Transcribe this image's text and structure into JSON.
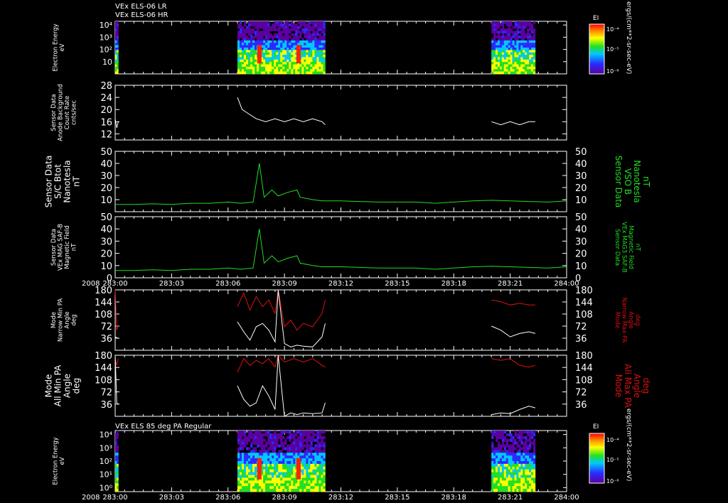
{
  "header": {
    "line1": "VEx ELS-06 LR",
    "line2": "VEx ELS-06 HR"
  },
  "year_label": "2008",
  "colorbar": {
    "label": "EI",
    "ticks": [
      "10⁻⁴",
      "10⁻⁵",
      "10⁻⁶"
    ],
    "units": "ergs/(cm**2-sr-sec-eV)"
  },
  "colors": {
    "trace_white": "#ffffff",
    "trace_green": "#22dd22",
    "trace_red": "#dd1111",
    "frame": "#ffffff"
  },
  "chart_data": [
    {
      "type": "heatmap",
      "id": "spec1",
      "ylabel": [
        "Electron Energy",
        "eV"
      ],
      "yticks": [
        "10⁴",
        "10³",
        "10²",
        "10"
      ],
      "ylog": true,
      "ylim": [
        1,
        20000
      ],
      "data_intervals": [
        [
          "283:00:00",
          "283:00:10"
        ],
        [
          "283:06:30",
          "283:11:10"
        ],
        [
          "283:20:00",
          "283:22:20"
        ]
      ]
    },
    {
      "type": "line",
      "id": "anode",
      "ylabel": [
        "Sensor Data",
        "Anode Background",
        "Count Rate",
        "cnts/sec"
      ],
      "yticks": [
        12,
        16,
        20,
        24,
        28
      ],
      "ylim": [
        10,
        28
      ],
      "series": [
        {
          "color": "#ffffff",
          "points": [
            [
              "283:00:00",
              17
            ],
            [
              "283:00:05",
              14
            ],
            [
              "283:00:10",
              16
            ],
            [
              "283:06:30",
              24
            ],
            [
              "283:06:45",
              20
            ],
            [
              "283:07:00",
              19
            ],
            [
              "283:07:30",
              17
            ],
            [
              "283:08:00",
              16
            ],
            [
              "283:08:30",
              17
            ],
            [
              "283:09:00",
              16
            ],
            [
              "283:09:30",
              17
            ],
            [
              "283:10:00",
              16
            ],
            [
              "283:10:30",
              17
            ],
            [
              "283:11:00",
              16
            ],
            [
              "283:11:10",
              15
            ],
            [
              "283:20:00",
              16
            ],
            [
              "283:20:30",
              15
            ],
            [
              "283:21:00",
              16
            ],
            [
              "283:21:30",
              15
            ],
            [
              "283:22:00",
              16
            ],
            [
              "283:22:20",
              16
            ]
          ]
        }
      ]
    },
    {
      "type": "line",
      "id": "bmag",
      "ylabel": [
        "Sensor Data",
        "S/C Btot",
        "Nanotesla",
        "nT"
      ],
      "ylabel_right": [
        "Sensor Data",
        "VSO B",
        "Nanotesla",
        "nT"
      ],
      "yticks": [
        10,
        20,
        30,
        40,
        50
      ],
      "ylim": [
        0,
        50
      ],
      "series": [
        {
          "color": "#22dd22",
          "points": [
            [
              "283:00:00",
              6
            ],
            [
              "283:01:00",
              6
            ],
            [
              "283:02:00",
              6.5
            ],
            [
              "283:03:00",
              6
            ],
            [
              "283:04:00",
              7
            ],
            [
              "283:05:00",
              7
            ],
            [
              "283:06:00",
              8
            ],
            [
              "283:06:40",
              7
            ],
            [
              "283:07:20",
              8
            ],
            [
              "283:07:40",
              40
            ],
            [
              "283:07:55",
              12
            ],
            [
              "283:08:20",
              18
            ],
            [
              "283:08:40",
              13
            ],
            [
              "283:09:10",
              16
            ],
            [
              "283:09:40",
              18
            ],
            [
              "283:09:50",
              12
            ],
            [
              "283:10:30",
              10
            ],
            [
              "283:11:00",
              9
            ],
            [
              "283:12:00",
              9
            ],
            [
              "283:13:00",
              8.5
            ],
            [
              "283:14:00",
              8
            ],
            [
              "283:15:00",
              8
            ],
            [
              "283:16:00",
              8
            ],
            [
              "283:17:00",
              7
            ],
            [
              "283:18:00",
              8
            ],
            [
              "283:19:00",
              9
            ],
            [
              "283:20:00",
              9.5
            ],
            [
              "283:21:00",
              9
            ],
            [
              "283:22:00",
              8.5
            ],
            [
              "283:23:00",
              8
            ],
            [
              "283:24:00",
              9
            ]
          ]
        }
      ]
    },
    {
      "type": "line",
      "id": "bmag2",
      "ylabel": [
        "Sensor Data",
        "VEx MAG SAF-B",
        "Magnetic Field",
        "nT"
      ],
      "ylabel_right": [
        "Sensor Data",
        "VEx MAG3 SAF-B",
        "Magnetic Field",
        "nT"
      ],
      "yticks": [
        0,
        10,
        20,
        30,
        40,
        50
      ],
      "ylim": [
        0,
        50
      ],
      "xticks": [
        "283:00",
        "283:03",
        "283:06",
        "283:09",
        "283:12",
        "283:15",
        "283:18",
        "283:21",
        "284:00"
      ],
      "series": [
        {
          "color": "#22dd22",
          "points": [
            [
              "283:00:00",
              6
            ],
            [
              "283:01:00",
              6
            ],
            [
              "283:02:00",
              6.5
            ],
            [
              "283:03:00",
              6
            ],
            [
              "283:04:00",
              7
            ],
            [
              "283:05:00",
              7
            ],
            [
              "283:06:00",
              8
            ],
            [
              "283:06:40",
              7
            ],
            [
              "283:07:20",
              8
            ],
            [
              "283:07:40",
              40
            ],
            [
              "283:07:55",
              12
            ],
            [
              "283:08:20",
              18
            ],
            [
              "283:08:40",
              13
            ],
            [
              "283:09:10",
              16
            ],
            [
              "283:09:40",
              18
            ],
            [
              "283:09:50",
              12
            ],
            [
              "283:10:30",
              10
            ],
            [
              "283:11:00",
              9
            ],
            [
              "283:12:00",
              9
            ],
            [
              "283:13:00",
              8.5
            ],
            [
              "283:14:00",
              8
            ],
            [
              "283:15:00",
              8
            ],
            [
              "283:16:00",
              8
            ],
            [
              "283:17:00",
              7
            ],
            [
              "283:18:00",
              8
            ],
            [
              "283:19:00",
              9
            ],
            [
              "283:20:00",
              9.5
            ],
            [
              "283:21:00",
              9
            ],
            [
              "283:22:00",
              8.5
            ],
            [
              "283:23:00",
              8
            ],
            [
              "283:24:00",
              9
            ]
          ]
        }
      ]
    },
    {
      "type": "line",
      "id": "pa_narrow",
      "ylabel": [
        "Mode",
        "Narrow Min PA",
        "Angle",
        "deg"
      ],
      "ylabel_right": [
        "Mode",
        "Narrow Max PA",
        "Angle",
        "deg"
      ],
      "yticks": [
        36,
        72,
        108,
        144,
        180
      ],
      "ylim": [
        0,
        180
      ],
      "series": [
        {
          "color": "#dd1111",
          "points": [
            [
              "283:00:00",
              180
            ],
            [
              "283:00:05",
              60
            ],
            [
              "283:00:10",
              75
            ],
            [
              "283:06:30",
              130
            ],
            [
              "283:06:50",
              170
            ],
            [
              "283:07:10",
              120
            ],
            [
              "283:07:30",
              160
            ],
            [
              "283:07:50",
              130
            ],
            [
              "283:08:10",
              150
            ],
            [
              "283:08:30",
              110
            ],
            [
              "283:08:40",
              180
            ],
            [
              "283:09:00",
              70
            ],
            [
              "283:09:20",
              90
            ],
            [
              "283:09:40",
              60
            ],
            [
              "283:10:00",
              80
            ],
            [
              "283:10:30",
              70
            ],
            [
              "283:11:00",
              110
            ],
            [
              "283:11:10",
              150
            ],
            [
              "283:20:00",
              150
            ],
            [
              "283:20:30",
              145
            ],
            [
              "283:21:00",
              135
            ],
            [
              "283:21:30",
              140
            ],
            [
              "283:22:00",
              135
            ],
            [
              "283:22:20",
              135
            ]
          ]
        },
        {
          "color": "#ffffff",
          "points": [
            [
              "283:00:00",
              40
            ],
            [
              "283:00:10",
              35
            ],
            [
              "283:06:30",
              85
            ],
            [
              "283:06:50",
              55
            ],
            [
              "283:07:10",
              30
            ],
            [
              "283:07:30",
              70
            ],
            [
              "283:07:50",
              80
            ],
            [
              "283:08:10",
              60
            ],
            [
              "283:08:30",
              25
            ],
            [
              "283:08:40",
              180
            ],
            [
              "283:09:00",
              20
            ],
            [
              "283:09:20",
              10
            ],
            [
              "283:09:40",
              15
            ],
            [
              "283:10:00",
              12
            ],
            [
              "283:10:30",
              10
            ],
            [
              "283:11:00",
              40
            ],
            [
              "283:11:10",
              80
            ],
            [
              "283:20:00",
              72
            ],
            [
              "283:20:30",
              60
            ],
            [
              "283:21:00",
              40
            ],
            [
              "283:21:30",
              50
            ],
            [
              "283:22:00",
              55
            ],
            [
              "283:22:20",
              50
            ]
          ]
        }
      ]
    },
    {
      "type": "line",
      "id": "pa_all",
      "ylabel": [
        "Mode",
        "All Min PA",
        "Angle",
        "deg"
      ],
      "ylabel_right": [
        "Mode",
        "All Max PA",
        "Angle",
        "deg"
      ],
      "yticks": [
        36,
        72,
        108,
        144,
        180
      ],
      "ylim": [
        0,
        180
      ],
      "series": [
        {
          "color": "#dd1111",
          "points": [
            [
              "283:00:00",
              170
            ],
            [
              "283:00:05",
              150
            ],
            [
              "283:00:10",
              170
            ],
            [
              "283:06:30",
              130
            ],
            [
              "283:06:50",
              170
            ],
            [
              "283:07:10",
              150
            ],
            [
              "283:07:30",
              165
            ],
            [
              "283:07:50",
              155
            ],
            [
              "283:08:10",
              170
            ],
            [
              "283:08:30",
              145
            ],
            [
              "283:08:40",
              180
            ],
            [
              "283:09:00",
              160
            ],
            [
              "283:09:30",
              170
            ],
            [
              "283:10:00",
              160
            ],
            [
              "283:10:30",
              170
            ],
            [
              "283:11:00",
              150
            ],
            [
              "283:11:10",
              145
            ],
            [
              "283:20:00",
              170
            ],
            [
              "283:20:30",
              165
            ],
            [
              "283:21:00",
              170
            ],
            [
              "283:21:30",
              150
            ],
            [
              "283:22:00",
              145
            ],
            [
              "283:22:20",
              150
            ]
          ]
        },
        {
          "color": "#ffffff",
          "points": [
            [
              "283:00:00",
              180
            ],
            [
              "283:00:05",
              40
            ],
            [
              "283:00:10",
              35
            ],
            [
              "283:06:30",
              90
            ],
            [
              "283:06:50",
              50
            ],
            [
              "283:07:10",
              30
            ],
            [
              "283:07:30",
              40
            ],
            [
              "283:07:50",
              90
            ],
            [
              "283:08:10",
              60
            ],
            [
              "283:08:30",
              20
            ],
            [
              "283:08:40",
              180
            ],
            [
              "283:09:00",
              0
            ],
            [
              "283:09:20",
              10
            ],
            [
              "283:09:40",
              5
            ],
            [
              "283:10:00",
              10
            ],
            [
              "283:10:30",
              8
            ],
            [
              "283:11:00",
              10
            ],
            [
              "283:11:10",
              40
            ],
            [
              "283:20:00",
              5
            ],
            [
              "283:20:30",
              10
            ],
            [
              "283:21:00",
              8
            ],
            [
              "283:21:30",
              20
            ],
            [
              "283:22:00",
              30
            ],
            [
              "283:22:20",
              25
            ]
          ]
        }
      ]
    },
    {
      "type": "heatmap",
      "id": "spec2",
      "title": "VEx ELS 85 deg PA Regular",
      "ylabel": [
        "Electron Energy",
        "eV"
      ],
      "yticks": [
        "10⁴",
        "10³",
        "10²",
        "10¹",
        "10⁰"
      ],
      "ylog": true,
      "ylim": [
        0.5,
        20000
      ],
      "xticks": [
        "283:00",
        "283:03",
        "283:06",
        "283:09",
        "283:12",
        "283:15",
        "283:18",
        "283:21",
        "284:00"
      ],
      "data_intervals": [
        [
          "283:00:00",
          "283:00:10"
        ],
        [
          "283:06:30",
          "283:11:10"
        ],
        [
          "283:20:00",
          "283:22:20"
        ]
      ]
    }
  ]
}
